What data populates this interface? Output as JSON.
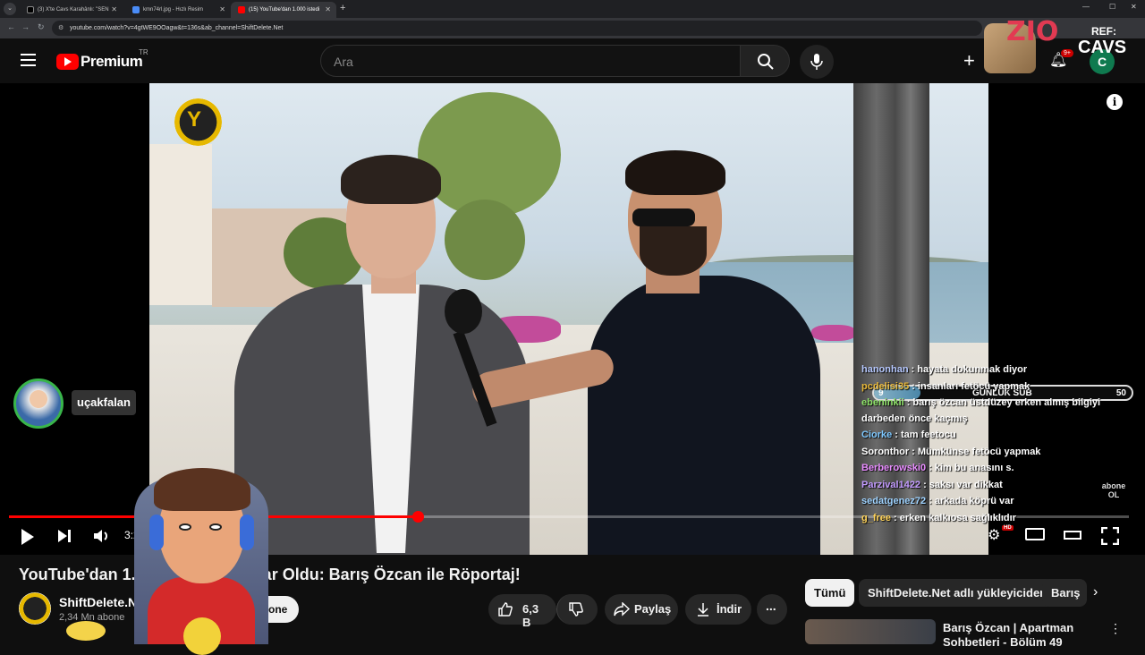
{
  "browser": {
    "tabs": [
      {
        "title": "(3) X'te Cavs Karahânlı: \"SEN",
        "icon_color": "#000000"
      },
      {
        "title": "kmn74rl.jpg - Hızlı Resim",
        "icon_color": "#4a8cf7"
      },
      {
        "title": "(15) YouTube'dan 1.000 istedi",
        "icon_color": "#ff0000"
      }
    ],
    "new_tab": "+",
    "url": "youtube.com/watch?v=4gtWE9OOagw&t=136s&ab_channel=ShiftDelete.Net"
  },
  "youtube": {
    "logo_text": "Premium",
    "region": "TR",
    "search_placeholder": "Ara",
    "avatar_letter": "C",
    "notification_count": "9+"
  },
  "stream_overlay": {
    "zio_text": "ZIO",
    "ref_label": "REF:",
    "ref_name": "CAVS",
    "alert_user": "uçakfalan",
    "sub_goal": {
      "current": "9",
      "label": "GÜNLÜK SUB",
      "target": "50",
      "progress": 0.18
    },
    "corner_text": "abone OL"
  },
  "player": {
    "time": "3:23",
    "progress_fraction": 0.365,
    "info_icon": "i"
  },
  "chat": [
    {
      "user": "hanonhan",
      "color": "#b7c9ff",
      "msg": ": hayata dokunmak diyor"
    },
    {
      "user": "pcdelisi35",
      "color": "#e8b83a",
      "msg": ": insanları fetöcü yapmak"
    },
    {
      "user": "ebeninkii",
      "color": "#8fe36a",
      "msg": ": barış özcan üstdüzey erken almış bilgiyi darbeden önce kaçmış"
    },
    {
      "user": "Ciorke",
      "color": "#7ec8ff",
      "msg": ": tam feetocu"
    },
    {
      "user": "Soronthor",
      "color": "#ffffff",
      "msg": ": Mümkünse fetöcü yapmak"
    },
    {
      "user": "Berberowski0",
      "color": "#e88dff",
      "msg": ": kim bu anasını s."
    },
    {
      "user": "Parzival1422",
      "color": "#c39bff",
      "msg": ": saksı var dikkat"
    },
    {
      "user": "sedatgenez72",
      "color": "#9fd3ff",
      "msg": ": arkada köprü var"
    },
    {
      "user": "g_free",
      "color": "#ffd35a",
      "msg": ": erken kalkıosa sağlıklıdır"
    }
  ],
  "video": {
    "title": "YouTube'dan 1.000 İstedi, 1 Milyar Oldu: Barış Özcan ile Röportaj!",
    "channel": "ShiftDelete.Net",
    "subscribers": "2,34 Mn abone",
    "subscribe_label": "Abone ol",
    "likes": "6,3 B",
    "share_label": "Paylaş",
    "download_label": "İndir",
    "more_label": "..."
  },
  "chips": {
    "all": "Tümü",
    "channel": "ShiftDelete.Net adlı yükleyiciden",
    "topic": "Barış"
  },
  "recommendation": {
    "title_line1": "Barış Özcan | Apartman",
    "title_line2": "Sohbetleri - Bölüm 49"
  }
}
